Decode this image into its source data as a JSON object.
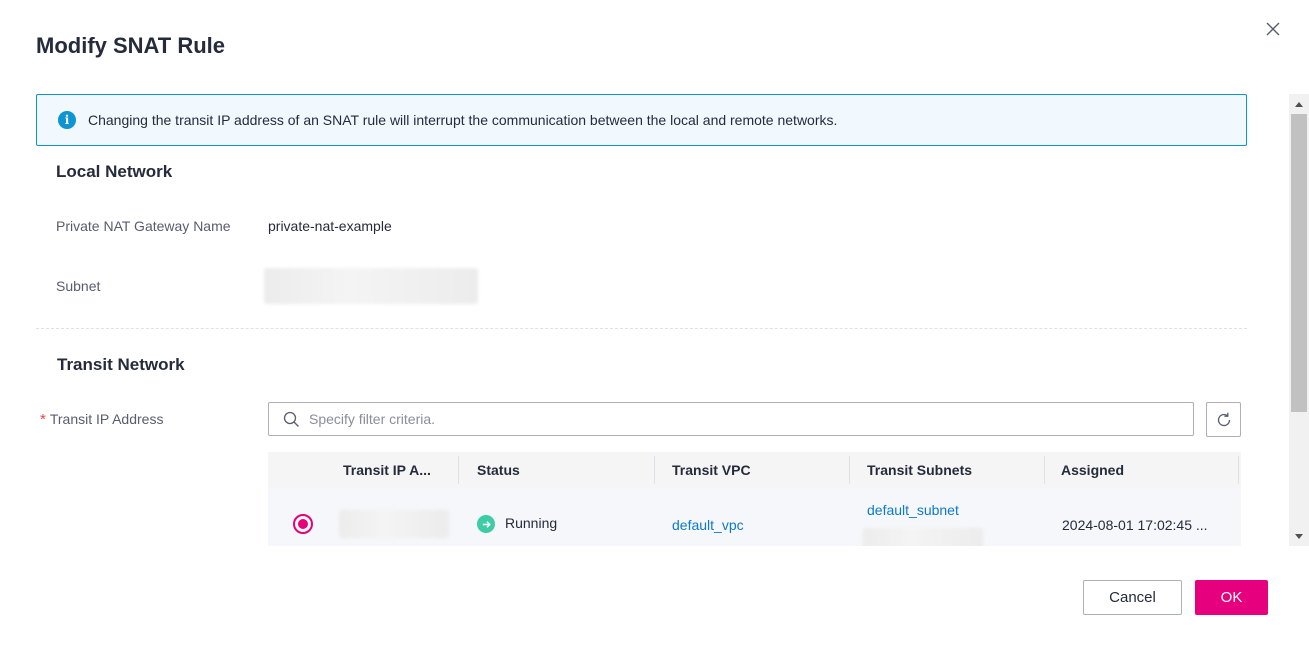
{
  "dialog": {
    "title": "Modify SNAT Rule",
    "close_icon": "close-icon"
  },
  "banner": {
    "icon": "info-icon",
    "icon_glyph": "i",
    "text": "Changing the transit IP address of an SNAT rule will interrupt the communication between the local and remote networks."
  },
  "local_network": {
    "title": "Local Network",
    "gateway_label": "Private NAT Gateway Name",
    "gateway_value": "private-nat-example",
    "subnet_label": "Subnet"
  },
  "transit_network": {
    "title": "Transit Network",
    "required_mark": "*",
    "ip_label": "Transit IP Address",
    "search_placeholder": "Specify filter criteria.",
    "search_icon": "search-icon",
    "refresh_icon": "refresh-icon"
  },
  "table": {
    "columns": [
      "Transit IP A...",
      "Status",
      "Transit VPC",
      "Transit Subnets",
      "Assigned"
    ],
    "rows": [
      {
        "selected": true,
        "status": "Running",
        "status_icon": "arrow-right-circle-icon",
        "vpc": "default_vpc",
        "subnet": "default_subnet",
        "assigned": "2024-08-01 17:02:45 ..."
      }
    ]
  },
  "footer": {
    "cancel_label": "Cancel",
    "ok_label": "OK"
  },
  "colors": {
    "primary": "#e6007e",
    "link": "#0d7acc",
    "info": "#0d94d2",
    "success": "#3dcca6"
  }
}
